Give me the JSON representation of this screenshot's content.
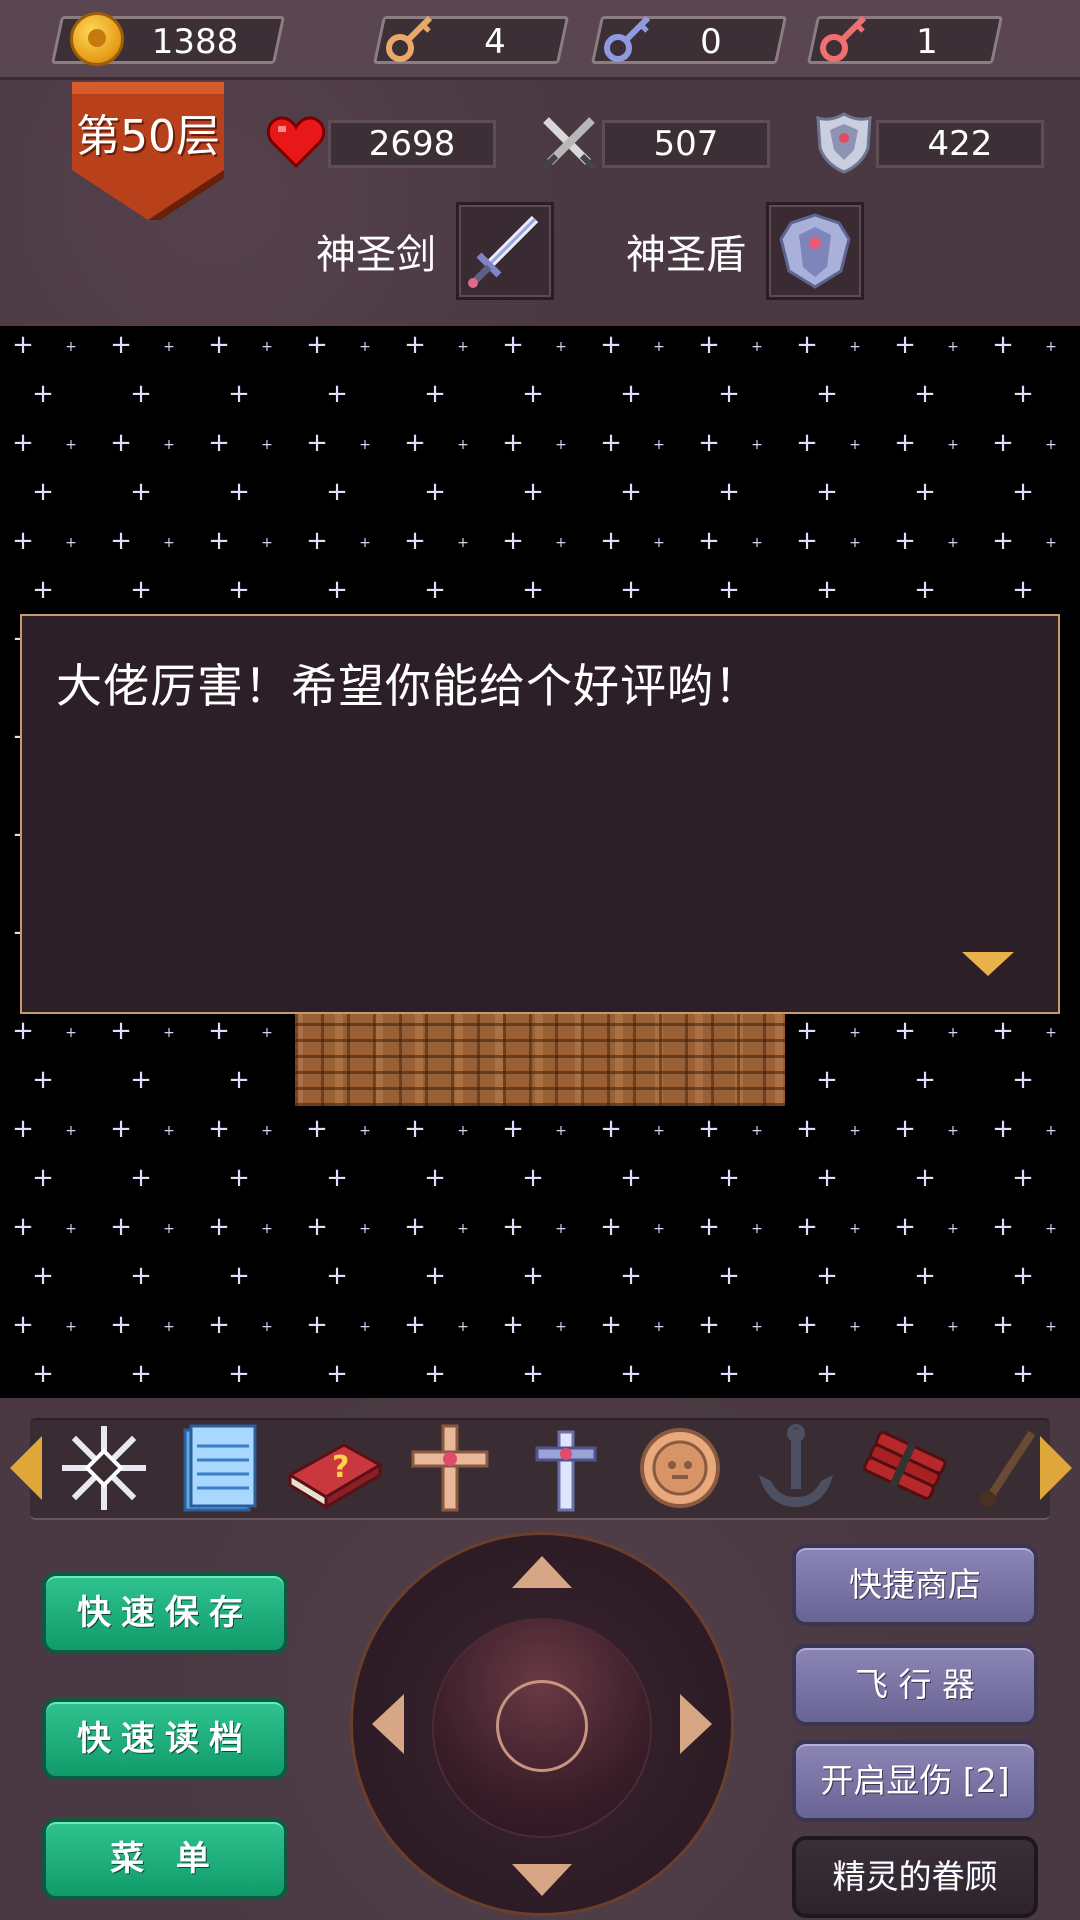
{
  "resources": {
    "gold": "1388",
    "yellow_keys": "4",
    "blue_keys": "0",
    "red_keys": "1"
  },
  "floor": {
    "label": "第50层"
  },
  "stats": {
    "hp": "2698",
    "attack": "507",
    "defense": "422"
  },
  "equipment": {
    "weapon_name": "神圣剑",
    "shield_name": "神圣盾"
  },
  "dialog": {
    "text": "大佬厉害！希望你能给个好评哟！"
  },
  "items": [
    "snowflake-icon",
    "notepad-icon",
    "monster-book-icon",
    "cross-icon",
    "holy-sword-icon",
    "coin-medallion-icon",
    "anchor-icon",
    "dynamite-icon",
    "pickaxe-icon"
  ],
  "buttons": {
    "quick_save": "快速保存",
    "quick_load": "快速读档",
    "menu": "菜 单",
    "quick_shop": "快捷商店",
    "flyer": "飞 行 器",
    "show_damage": "开启显伤 [2]",
    "fairy_favor": "精灵的眷顾"
  },
  "colors": {
    "hud_bg": "#4a3942",
    "dialog_border": "#c8996a",
    "green_button": "#1db47e",
    "purple_button": "#7d77a8",
    "gold": "#e59b16",
    "yellow_key": "#e7a86a",
    "blue_key": "#8f9ae0",
    "red_key": "#f07070"
  }
}
